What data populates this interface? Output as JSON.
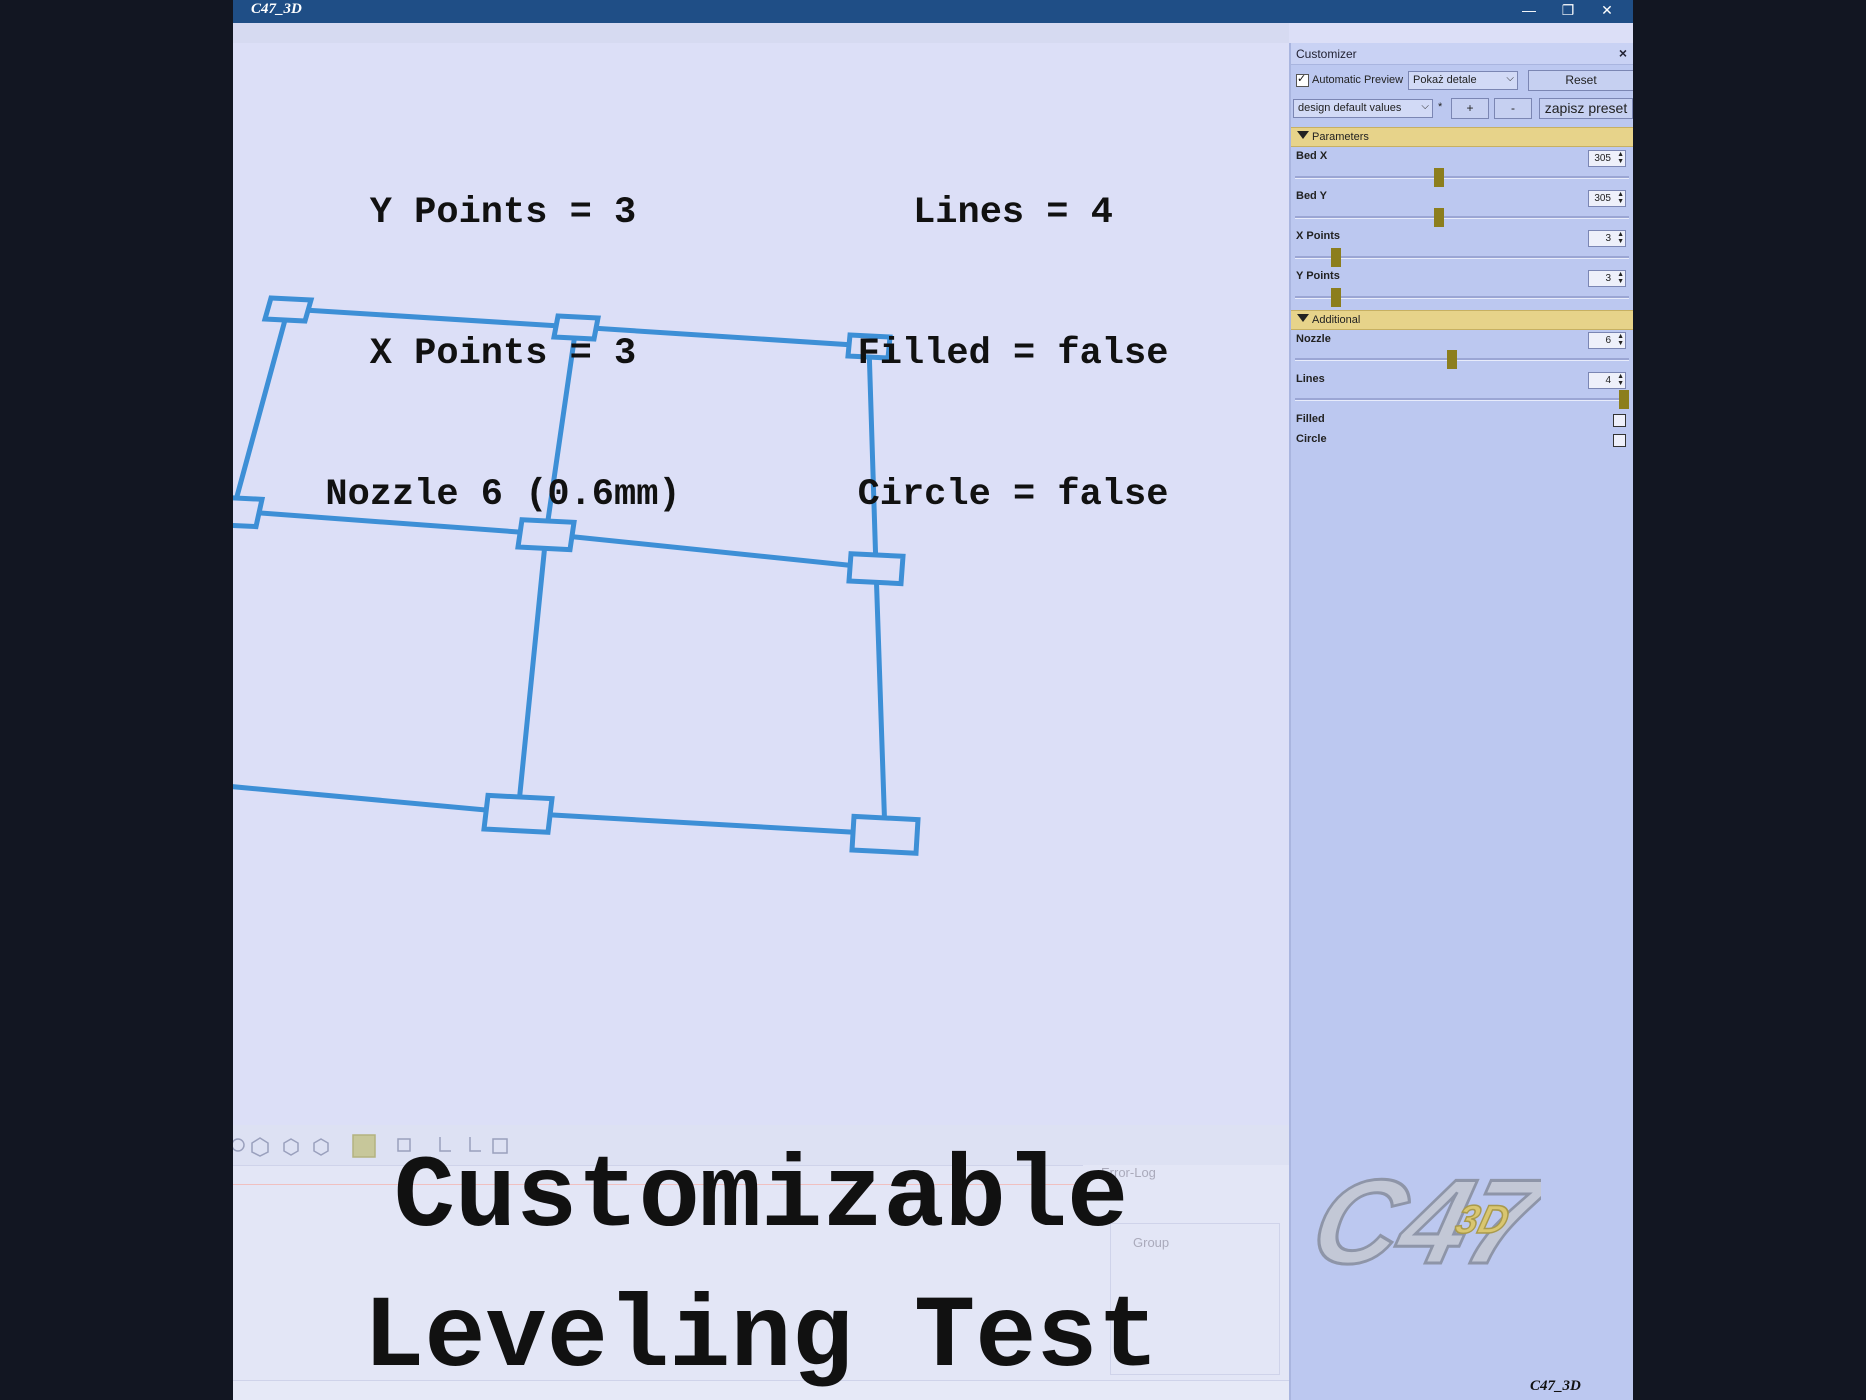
{
  "window": {
    "title": "C47_3D",
    "minimize": "—",
    "restore": "❐",
    "close": "✕"
  },
  "viewport": {
    "info_left": [
      "Y Points = 3",
      "X Points = 3",
      "Nozzle 6 (0.6mm)"
    ],
    "info_right": [
      "Lines = 4",
      "Filled = false",
      "Circle = false"
    ],
    "big_title_line1": "Customizable",
    "big_title_line2": "Leveling Test",
    "grid_color": "#3d8fd6"
  },
  "lower_panel": {
    "error_log_label": "Error-Log",
    "group_label": "Group"
  },
  "customizer": {
    "title": "Customizer",
    "close": "×",
    "automatic_preview_label": "Automatic Preview",
    "automatic_preview_checked": true,
    "detail_combo": "Pokaż detale",
    "reset_label": "Reset",
    "preset_combo": "design default values",
    "preset_modified_mark": "*",
    "add_label": "+",
    "remove_label": "-",
    "save_preset_label": "zapisz preset",
    "accent_color": "#e7d38a",
    "slider_color": "#8c7e1d",
    "sections": [
      {
        "name": "Parameters",
        "params": [
          {
            "label": "Bed X",
            "value": "305",
            "fraction": 0.43
          },
          {
            "label": "Bed Y",
            "value": "305",
            "fraction": 0.43
          },
          {
            "label": "X Points",
            "value": "3",
            "fraction": 0.11
          },
          {
            "label": "Y Points",
            "value": "3",
            "fraction": 0.11
          }
        ]
      },
      {
        "name": "Additional",
        "params": [
          {
            "label": "Nozzle",
            "value": "6",
            "fraction": 0.47
          },
          {
            "label": "Lines",
            "value": "4",
            "fraction": 1.0
          },
          {
            "label": "Filled",
            "checked": false
          },
          {
            "label": "Circle",
            "checked": false
          }
        ]
      }
    ],
    "logo_text": "C47",
    "logo_sub": "3D"
  },
  "footer_signature": "C47_3D"
}
